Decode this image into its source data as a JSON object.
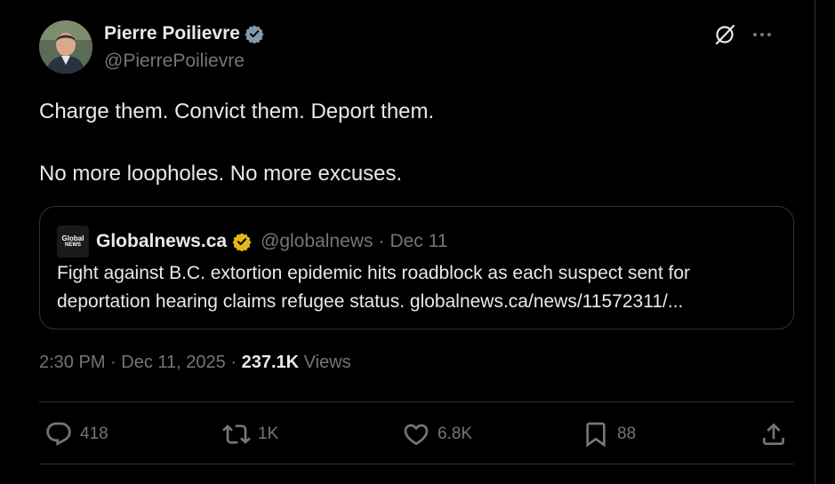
{
  "author": {
    "name": "Pierre Poilievre",
    "handle": "@PierrePoilievre",
    "verified_color": "#829aab"
  },
  "tweet": {
    "lines": [
      "Charge them. Convict them. Deport them.",
      "No more loopholes. No more excuses."
    ]
  },
  "quote": {
    "logo_text_top": "Global",
    "logo_text_bottom": "NEWS",
    "name": "Globalnews.ca",
    "handle": "@globalnews",
    "separator": "·",
    "date": "Dec 11",
    "verified_color": "#e2b719",
    "text": "Fight against B.C. extortion epidemic hits roadblock as each suspect sent for deportation hearing claims refugee status. globalnews.ca/news/11572311/..."
  },
  "meta": {
    "time": "2:30 PM",
    "sep1": "·",
    "date": "Dec 11, 2025",
    "sep2": "·",
    "views_count": "237.1K",
    "views_label": "Views"
  },
  "actions": {
    "replies": "418",
    "reposts": "1K",
    "likes": "6.8K",
    "bookmarks": "88"
  },
  "icons": {
    "grok": "grok-icon",
    "more": "more-icon",
    "reply": "reply-icon",
    "repost": "repost-icon",
    "like": "heart-icon",
    "bookmark": "bookmark-icon",
    "share": "share-icon"
  },
  "colors": {
    "background": "#000000",
    "text": "#e7e9ea",
    "secondary": "#71767b",
    "border": "#2f3336"
  }
}
